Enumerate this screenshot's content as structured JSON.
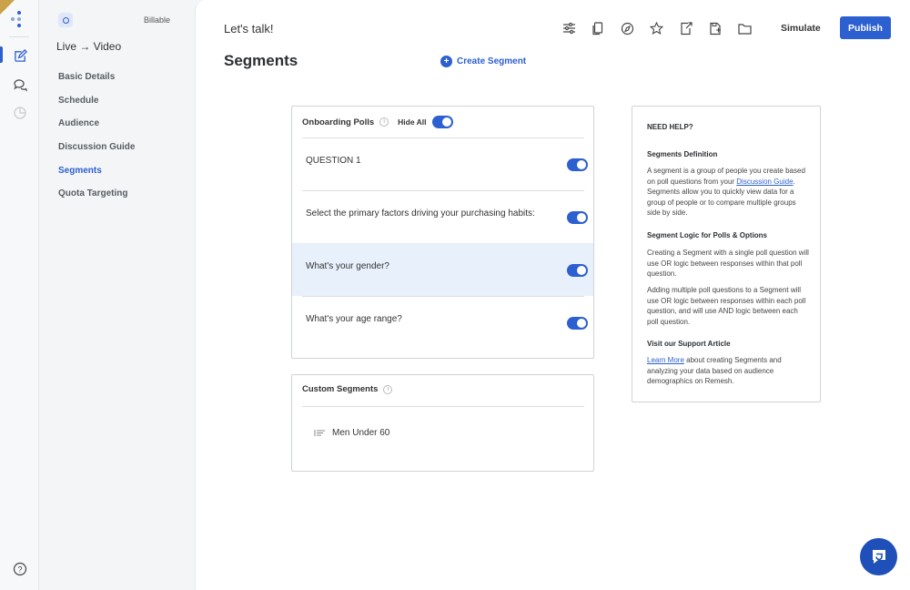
{
  "sidebar": {
    "billable_label": "Billable",
    "project_title": "Live → Video",
    "items": [
      {
        "label": "Basic Details"
      },
      {
        "label": "Schedule"
      },
      {
        "label": "Audience"
      },
      {
        "label": "Discussion Guide"
      },
      {
        "label": "Segments",
        "active": true
      },
      {
        "label": "Quota Targeting"
      }
    ]
  },
  "header": {
    "subtitle": "Let's talk!",
    "title": "Segments",
    "create_segment": "Create Segment",
    "simulate": "Simulate",
    "publish": "Publish",
    "toolbar_icons": [
      "sliders-icon",
      "copy-icon",
      "compass-icon",
      "star-icon",
      "export-icon",
      "save-icon",
      "folder-icon"
    ]
  },
  "polls": {
    "title": "Onboarding Polls",
    "hide_all": "Hide All",
    "hide_all_on": true,
    "questions": [
      {
        "text": "QUESTION 1",
        "on": true
      },
      {
        "text": "Select the primary factors driving your purchasing habits:",
        "on": true
      },
      {
        "text": "What's your gender?",
        "on": true,
        "highlighted": true
      },
      {
        "text": "What's your age range?",
        "on": true
      }
    ]
  },
  "custom_segments": {
    "title": "Custom Segments",
    "items": [
      {
        "label": "Men Under 60"
      }
    ]
  },
  "help": {
    "title": "NEED HELP?",
    "sections": [
      {
        "heading": "Segments Definition",
        "paragraphs": [
          {
            "pre": "A segment is a group of people you create based on poll questions from your ",
            "link": "Discussion Guide",
            "post": ". Segments allow you to quickly view data for a group of people or to compare multiple groups side by side."
          }
        ]
      },
      {
        "heading": "Segment Logic for Polls & Options",
        "paragraphs": [
          {
            "text": "Creating a Segment with a single poll question will use OR logic between responses within that poll question."
          },
          {
            "text": "Adding multiple poll questions to a Segment will use OR logic between responses within each poll question, and will use AND logic between each poll question."
          }
        ]
      },
      {
        "heading": "Visit our Support Article",
        "paragraphs": [
          {
            "link": "Learn More",
            "post": " about creating Segments and analyzing your data based on audience demographics on Remesh."
          }
        ]
      }
    ]
  },
  "colors": {
    "accent": "#2c5fcf",
    "highlight_row": "#e8f0fc",
    "publish_bg": "#2c5fcf",
    "chat_bg": "#1f4fb8"
  }
}
